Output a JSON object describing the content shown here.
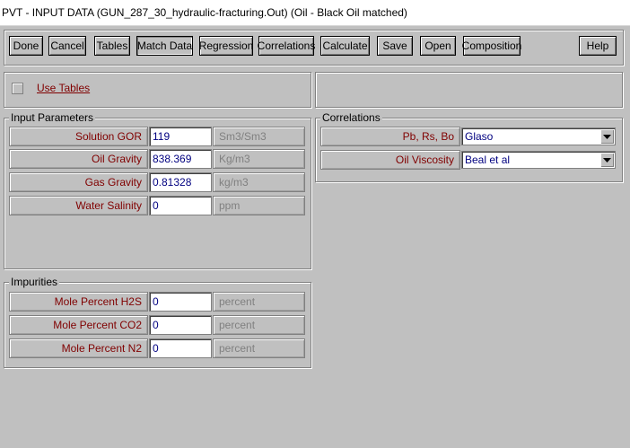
{
  "window": {
    "title": "PVT - INPUT DATA (GUN_287_30_hydraulic-fracturing.Out)  (Oil - Black Oil matched)"
  },
  "toolbar": {
    "buttons": [
      {
        "label": "Done"
      },
      {
        "label": "Cancel"
      },
      {
        "label": "Tables"
      },
      {
        "label": "Match Data"
      },
      {
        "label": "Regression"
      },
      {
        "label": "Correlations"
      },
      {
        "label": "Calculate"
      },
      {
        "label": "Save"
      },
      {
        "label": "Open"
      },
      {
        "label": "Composition"
      },
      {
        "label": "Help"
      }
    ]
  },
  "use_tables": {
    "label": "Use Tables",
    "checked": false
  },
  "input_parameters": {
    "title": "Input Parameters",
    "rows": [
      {
        "label": "Solution GOR",
        "value": "119",
        "unit": "Sm3/Sm3"
      },
      {
        "label": "Oil Gravity",
        "value": "838.369",
        "unit": "Kg/m3"
      },
      {
        "label": "Gas Gravity",
        "value": "0.81328",
        "unit": "kg/m3"
      },
      {
        "label": "Water Salinity",
        "value": "0",
        "unit": "ppm"
      }
    ]
  },
  "impurities": {
    "title": "Impurities",
    "rows": [
      {
        "label": "Mole Percent H2S",
        "value": "0",
        "unit": "percent"
      },
      {
        "label": "Mole Percent CO2",
        "value": "0",
        "unit": "percent"
      },
      {
        "label": "Mole Percent N2",
        "value": "0",
        "unit": "percent"
      }
    ]
  },
  "correlations": {
    "title": "Correlations",
    "rows": [
      {
        "label": "Pb, Rs, Bo",
        "value": "Glaso"
      },
      {
        "label": "Oil Viscosity",
        "value": "Beal et al"
      }
    ]
  },
  "colors": {
    "background": "#c0c0c0",
    "label_text": "#800000",
    "input_text": "#000080",
    "unit_text": "#808080"
  }
}
